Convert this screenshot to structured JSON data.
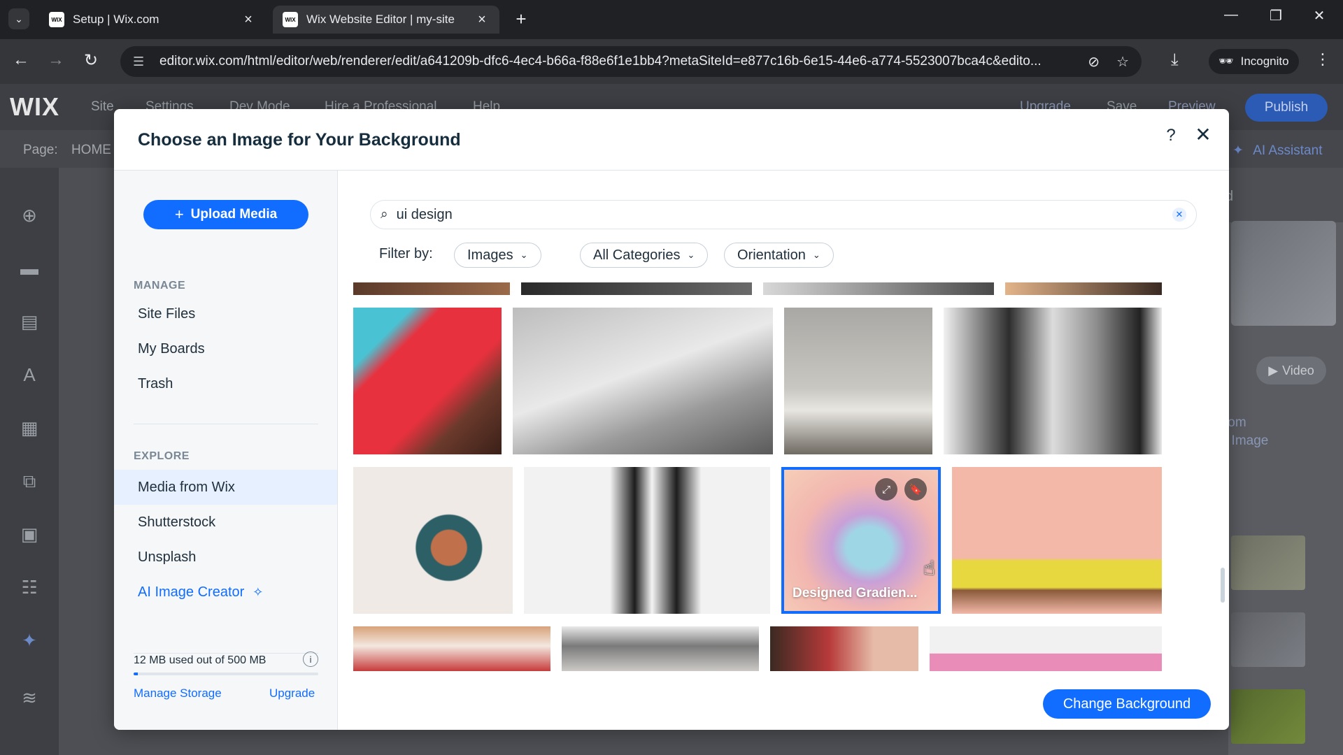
{
  "browser": {
    "tabs": [
      {
        "title": "Setup | Wix.com",
        "favicon": "WIX"
      },
      {
        "title": "Wix Website Editor | my-site",
        "favicon": "WIX"
      }
    ],
    "url": "editor.wix.com/html/editor/web/renderer/edit/a641209b-dfc6-4ec4-b66a-f88e6f1e1bb4?metaSiteId=e877c16b-6e15-44e6-a774-5523007bca4c&edito...",
    "incognito_label": "Incognito"
  },
  "editor": {
    "logo": "WIX",
    "menu": [
      "Site",
      "Settings",
      "Dev Mode",
      "Hire a Professional",
      "Help"
    ],
    "right_menu": [
      "Upgrade",
      "Save",
      "Preview"
    ],
    "publish_label": "Publish",
    "page_label": "Page:",
    "page_name": "HOME",
    "ai_assistant": "AI Assistant",
    "video_label": "Video",
    "custom_line1": "tom",
    "custom_line2": "I Image",
    "panel_letter": "d"
  },
  "modal": {
    "title": "Choose an Image for Your Background",
    "upload_label": "Upload Media",
    "manage_label": "MANAGE",
    "manage_items": [
      "Site Files",
      "My Boards",
      "Trash"
    ],
    "explore_label": "EXPLORE",
    "explore_items": [
      "Media from Wix",
      "Shutterstock",
      "Unsplash"
    ],
    "ai_creator": "AI Image Creator",
    "storage": {
      "text": "12 MB used out of 500 MB",
      "used_fraction": 0.024
    },
    "manage_storage": "Manage Storage",
    "upgrade": "Upgrade",
    "search_value": "ui design",
    "filter_label": "Filter by:",
    "filters": [
      "Images",
      "All Categories",
      "Orientation"
    ],
    "selected_caption": "Designed Gradien...",
    "change_button": "Change Background"
  },
  "colors": {
    "accent": "#116dff",
    "selected_bg": "#e7f0ff"
  }
}
